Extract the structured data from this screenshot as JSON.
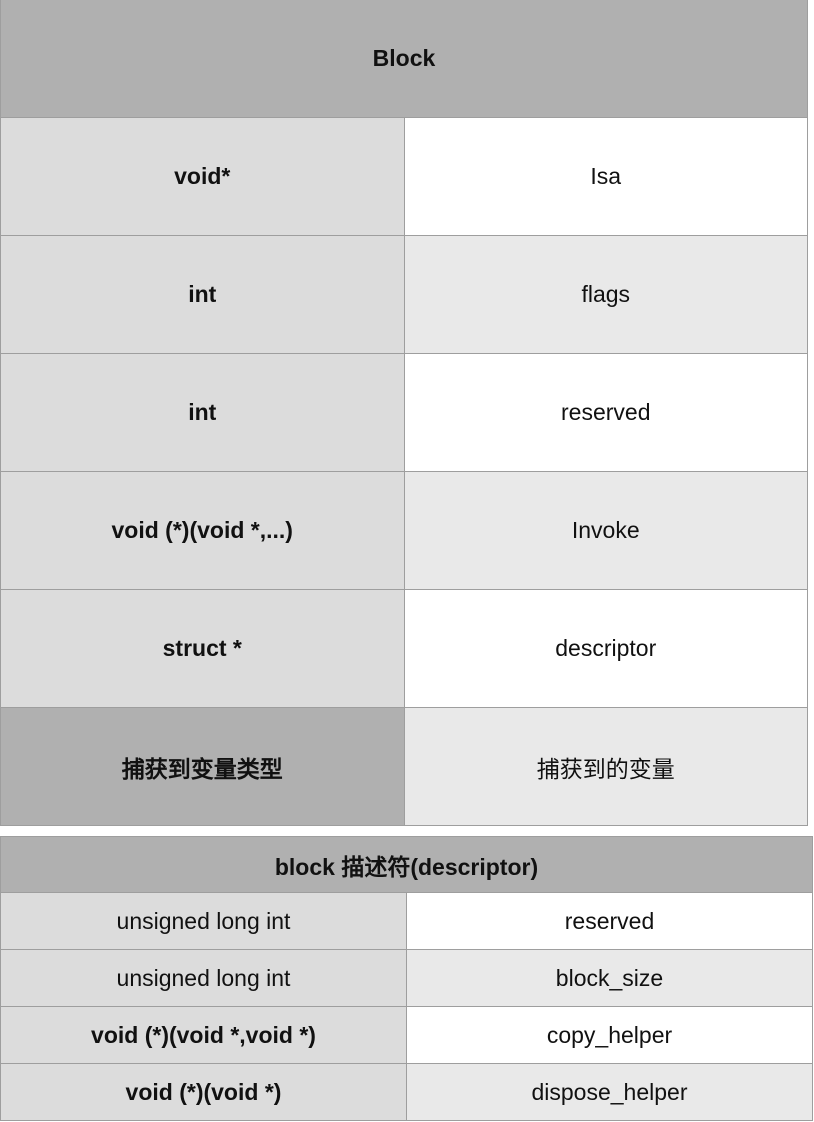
{
  "block_table": {
    "title": "Block",
    "rows": [
      {
        "type": "void*",
        "name": "Isa"
      },
      {
        "type": "int",
        "name": "flags"
      },
      {
        "type": "int",
        "name": "reserved"
      },
      {
        "type": "void (*)(void *,...)",
        "name": "Invoke"
      },
      {
        "type": "struct *",
        "name": "descriptor"
      },
      {
        "type": "捕获到变量类型",
        "name": "捕获到的变量"
      }
    ]
  },
  "descriptor_table": {
    "title": "block 描述符(descriptor)",
    "rows": [
      {
        "type": "unsigned long int",
        "name": "reserved"
      },
      {
        "type": "unsigned long int",
        "name": "block_size"
      },
      {
        "type": "void (*)(void *,void *)",
        "name": "copy_helper"
      },
      {
        "type": "void (*)(void *)",
        "name": "dispose_helper"
      }
    ]
  }
}
